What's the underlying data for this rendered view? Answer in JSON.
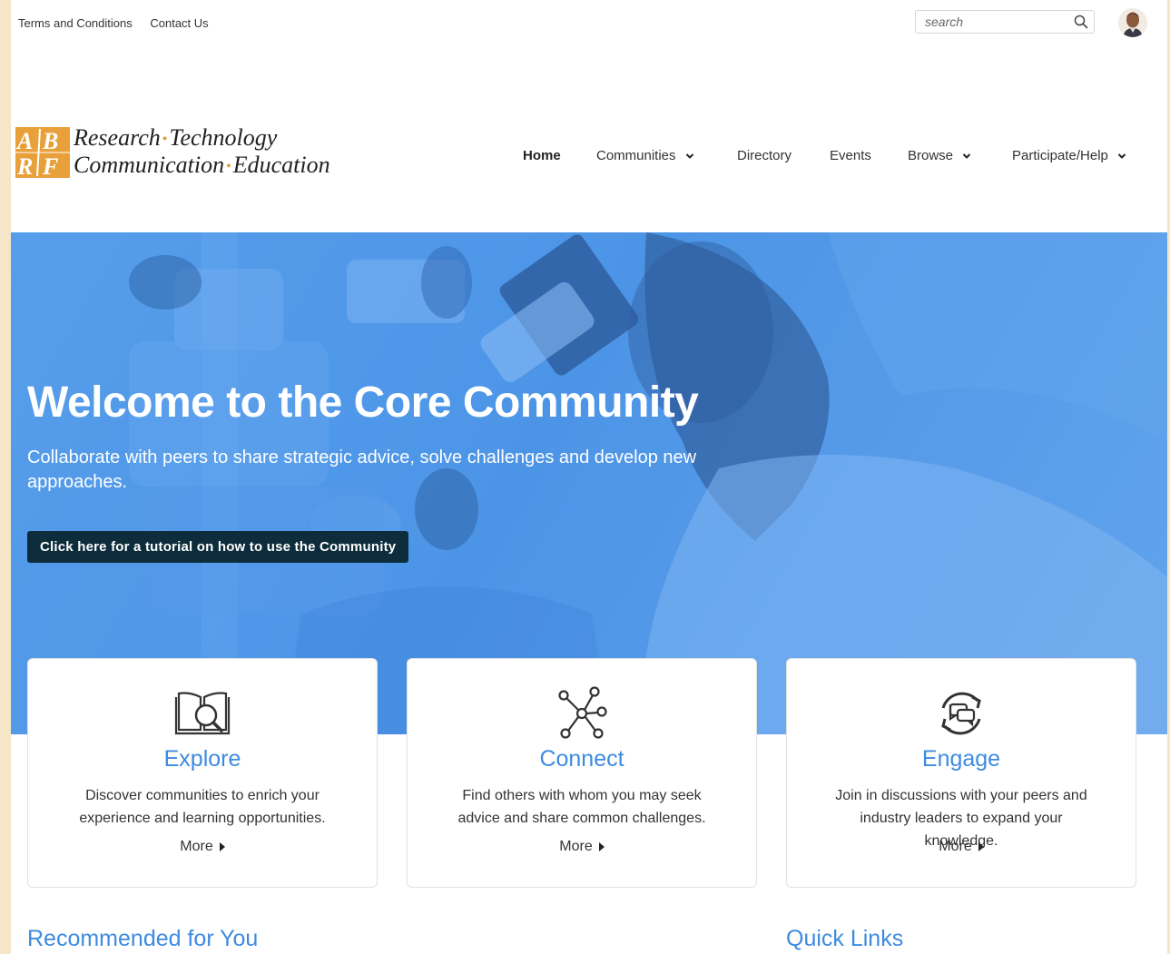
{
  "util_bar": {
    "links": [
      "Terms and Conditions",
      "Contact Us"
    ],
    "search_placeholder": "search"
  },
  "logo": {
    "mark": "AB RF",
    "line1": [
      "Research",
      "Technology"
    ],
    "line2": [
      "Communication",
      "Education"
    ]
  },
  "nav": {
    "items": [
      {
        "label": "Home",
        "has_dropdown": false
      },
      {
        "label": "Communities",
        "has_dropdown": true
      },
      {
        "label": "Directory",
        "has_dropdown": false
      },
      {
        "label": "Events",
        "has_dropdown": false
      },
      {
        "label": "Browse",
        "has_dropdown": true
      },
      {
        "label": "Participate/Help",
        "has_dropdown": true
      }
    ]
  },
  "hero": {
    "title": "Welcome to the Core Community",
    "subtitle": "Collaborate with peers to share strategic advice, solve challenges and develop new approaches.",
    "button_label": "Click here for a tutorial on how to use the Community"
  },
  "cards": [
    {
      "icon": "book-search-icon",
      "title": "Explore",
      "description": "Discover communities to enrich your experience and learning opportunities.",
      "more": "More"
    },
    {
      "icon": "network-icon",
      "title": "Connect",
      "description": "Find others with whom you may seek advice and share common challenges.",
      "more": "More"
    },
    {
      "icon": "discussion-cycle-icon",
      "title": "Engage",
      "description": "Join in discussions with your peers and industry leaders to expand your knowledge.",
      "more": "More"
    }
  ],
  "sections": {
    "recommended": "Recommended for You",
    "quick_links": "Quick Links"
  },
  "colors": {
    "accent": "#3d8be0",
    "hero_blue": "#4d95e6",
    "button_dark": "#0d2c3c",
    "logo_orange": "#e09a2a"
  }
}
